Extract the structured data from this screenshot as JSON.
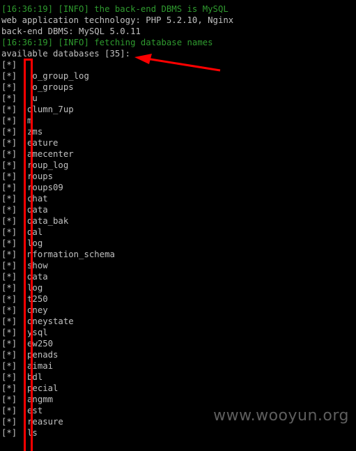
{
  "window": {
    "background": "#000000",
    "info_color": "#2f9b2f",
    "text_color": "#c0c0c0",
    "annotation_color": "#ff0000"
  },
  "terminal": {
    "lines": [
      {
        "text": "[16:36:19] [INFO] the back-end DBMS is MySQL",
        "type": "info"
      },
      {
        "text": "web application technology: PHP 5.2.10, Nginx",
        "type": "plain"
      },
      {
        "text": "back-end DBMS: MySQL 5.0.11",
        "type": "plain"
      },
      {
        "text": "[16:36:19] [INFO] fetching database names",
        "type": "info"
      },
      {
        "text": "available databases [35]:",
        "type": "plain"
      },
      {
        "text": "[*] ",
        "type": "plain"
      },
      {
        "text": "[*]   o_group_log",
        "type": "plain"
      },
      {
        "text": "[*]   o_groups",
        "type": "plain"
      },
      {
        "text": "[*]   u",
        "type": "plain"
      },
      {
        "text": "[*]  olumn_7up",
        "type": "plain"
      },
      {
        "text": "[*]  m",
        "type": "plain"
      },
      {
        "text": "[*]  zms",
        "type": "plain"
      },
      {
        "text": "[*]  eature",
        "type": "plain"
      },
      {
        "text": "[*]  amecenter",
        "type": "plain"
      },
      {
        "text": "[*]  roup_log",
        "type": "plain"
      },
      {
        "text": "[*]  roups",
        "type": "plain"
      },
      {
        "text": "[*]  roups09",
        "type": "plain"
      },
      {
        "text": "[*]  chat",
        "type": "plain"
      },
      {
        "text": "[*]  data",
        "type": "plain"
      },
      {
        "text": "[*]  data_bak",
        "type": "plain"
      },
      {
        "text": "[*]  dal",
        "type": "plain"
      },
      {
        "text": "[*]  log",
        "type": "plain"
      },
      {
        "text": "[*]  nformation_schema",
        "type": "plain"
      },
      {
        "text": "[*]  show",
        "type": "plain"
      },
      {
        "text": "[*]  data",
        "type": "plain"
      },
      {
        "text": "[*]  log",
        "type": "plain"
      },
      {
        "text": "[*]  t250",
        "type": "plain"
      },
      {
        "text": "[*]  oney",
        "type": "plain"
      },
      {
        "text": "[*]  oneystate",
        "type": "plain"
      },
      {
        "text": "[*]  ysql",
        "type": "plain"
      },
      {
        "text": "[*]  ew250",
        "type": "plain"
      },
      {
        "text": "[*]  penads",
        "type": "plain"
      },
      {
        "text": "[*]  aimai",
        "type": "plain"
      },
      {
        "text": "[*]  bdl",
        "type": "plain"
      },
      {
        "text": "[*]  pecial",
        "type": "plain"
      },
      {
        "text": "[*]  angmm",
        "type": "plain"
      },
      {
        "text": "[*]  est",
        "type": "plain"
      },
      {
        "text": "[*]  reasure",
        "type": "plain"
      },
      {
        "text": "[*]  ls",
        "type": "plain"
      }
    ]
  },
  "watermark": "www.wooyun.org"
}
